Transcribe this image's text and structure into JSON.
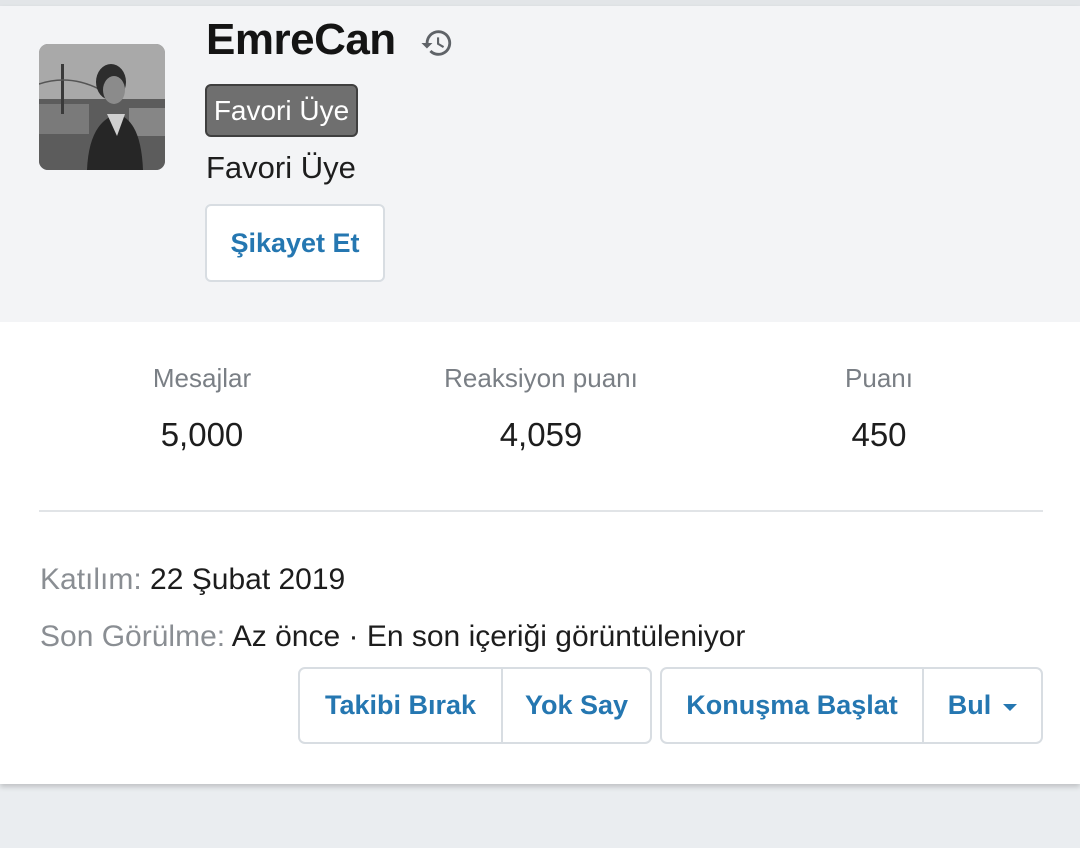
{
  "profile": {
    "username": "EmreCan",
    "badge": "Favori Üye",
    "title": "Favori Üye",
    "report_button": "Şikayet Et"
  },
  "stats": [
    {
      "label": "Mesajlar",
      "value": "5,000"
    },
    {
      "label": "Reaksiyon puanı",
      "value": "4,059"
    },
    {
      "label": "Puanı",
      "value": "450"
    }
  ],
  "info": {
    "joined_label": "Katılım:",
    "joined_value": "22 Şubat 2019",
    "last_seen_label": "Son Görülme:",
    "last_seen_value": "Az önce · En son içeriği görüntüleniyor"
  },
  "actions": {
    "unfollow": "Takibi Bırak",
    "ignore": "Yok Say",
    "start_conversation": "Konuşma Başlat",
    "find": "Bul"
  },
  "colors": {
    "accent": "#2577b1",
    "badge_bg": "#6f6f6f",
    "header_bg": "#f3f4f6",
    "page_bg": "#eaedf0"
  },
  "icons": {
    "history": "history-icon",
    "dropdown": "caret-down-icon"
  }
}
